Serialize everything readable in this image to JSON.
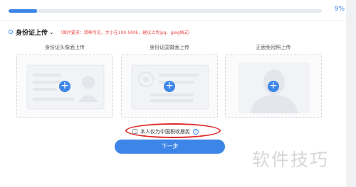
{
  "progress": {
    "percent_text": "9%",
    "fraction": 0.09
  },
  "section": {
    "title": "身份证上传",
    "requirement_note": "（图片要求：清晰可见，大小在100-500k，建议上传jpg、jpeg格式）"
  },
  "cards": [
    {
      "label": "身份证头像面上传"
    },
    {
      "label": "身份证国徽面上传"
    },
    {
      "label": "正面免冠照上传"
    }
  ],
  "resident_checkbox": {
    "label": "本人仅为中国税收居民",
    "checked": false
  },
  "next_button": {
    "label": "下一步"
  },
  "watermark": {
    "text": "软件技巧"
  },
  "colors": {
    "accent": "#3d86e8",
    "highlight_ellipse": "#e02a2a",
    "note_red": "#e94a4a"
  },
  "icons": {
    "section_bullet": "bullet-circle-icon",
    "dropdown": "chevron-down-icon",
    "upload": "plus-icon",
    "info": "question-icon",
    "card1_illustration": "id-card-front-icon",
    "card2_illustration": "id-card-emblem-icon",
    "card3_illustration": "portrait-silhouette-icon"
  }
}
